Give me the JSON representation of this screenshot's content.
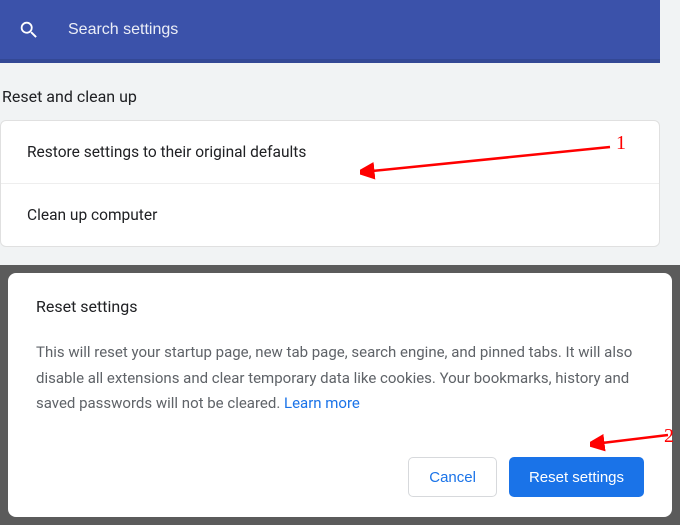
{
  "search": {
    "placeholder": "Search settings"
  },
  "section": {
    "title": "Reset and clean up"
  },
  "rows": {
    "restore": "Restore settings to their original defaults",
    "cleanup": "Clean up computer"
  },
  "modal": {
    "title": "Reset settings",
    "body": "This will reset your startup page, new tab page, search engine, and pinned tabs. It will also disable all extensions and clear temporary data like cookies. Your bookmarks, history and saved passwords will not be cleared. ",
    "learn_more": "Learn more",
    "cancel": "Cancel",
    "reset": "Reset settings"
  },
  "annotations": {
    "one": "1",
    "two": "2"
  }
}
